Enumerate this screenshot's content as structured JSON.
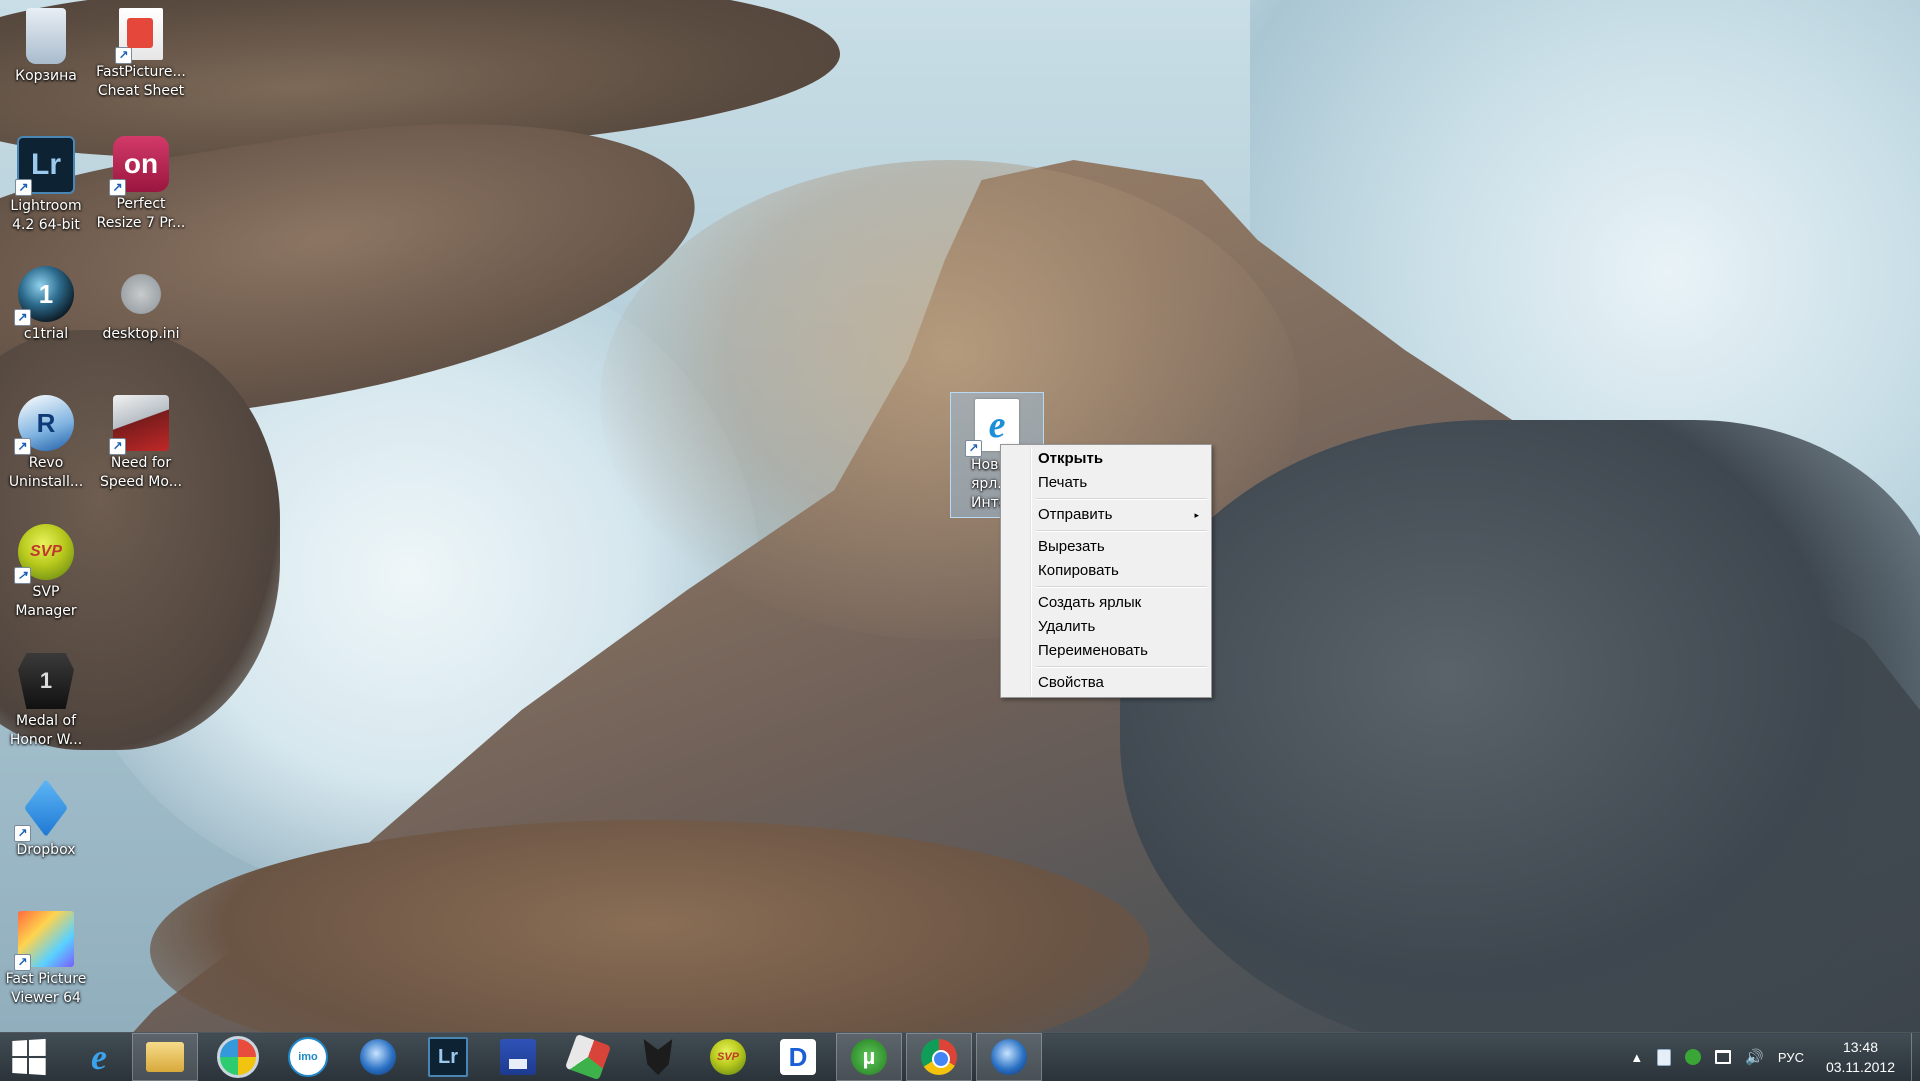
{
  "desktop": {
    "icons": [
      {
        "label": "Корзина",
        "icon": "recycle-bin-icon"
      },
      {
        "label": "FastPicture... Cheat Sheet",
        "icon": "pdf-document-icon"
      },
      {
        "label": "Lightroom 4.2 64-bit",
        "icon": "lightroom-icon"
      },
      {
        "label": "Perfect Resize 7 Pr...",
        "icon": "perfect-resize-icon"
      },
      {
        "label": "c1trial",
        "icon": "capture-one-icon"
      },
      {
        "label": "desktop.ini",
        "icon": "gear-settings-file-icon"
      },
      {
        "label": "Revo Uninstall...",
        "icon": "revo-uninstaller-icon"
      },
      {
        "label": "Need for Speed Mo...",
        "icon": "need-for-speed-icon"
      },
      {
        "label": "SVP Manager",
        "icon": "svp-icon"
      },
      {
        "label": "Medal of Honor W...",
        "icon": "medal-of-honor-icon"
      },
      {
        "label": "Dropbox",
        "icon": "dropbox-icon"
      },
      {
        "label": "Fast Picture Viewer 64",
        "icon": "fast-picture-viewer-icon"
      }
    ],
    "glyphs": {
      "lightroom": "Lr",
      "perfect_resize": "on",
      "c1": "1",
      "revo": "R",
      "svp": "SVP",
      "moh": "1",
      "ie": "e",
      "shortcut": "↗"
    },
    "selected_shortcut": {
      "label": "Нов... ярл... Интер...",
      "icon": "internet-explorer-shortcut-icon"
    }
  },
  "context_menu": {
    "items": [
      {
        "label": "Открыть",
        "bold": true
      },
      {
        "label": "Печать"
      },
      {
        "separator": true
      },
      {
        "label": "Отправить",
        "submenu": true
      },
      {
        "separator": true
      },
      {
        "label": "Вырезать"
      },
      {
        "label": "Копировать"
      },
      {
        "separator": true
      },
      {
        "label": "Создать ярлык"
      },
      {
        "label": "Удалить"
      },
      {
        "label": "Переименовать"
      },
      {
        "separator": true
      },
      {
        "label": "Свойства"
      }
    ],
    "submenu_arrow": "▸"
  },
  "taskbar": {
    "pinned": [
      {
        "name": "internet-explorer",
        "icon": "internet-explorer-icon",
        "glyph": "e"
      },
      {
        "name": "file-explorer",
        "icon": "folder-icon",
        "glyph": ""
      },
      {
        "name": "picasa",
        "icon": "picasa-icon",
        "glyph": ""
      },
      {
        "name": "imo",
        "icon": "imo-messenger-icon",
        "glyph": "imo"
      },
      {
        "name": "thunderbird",
        "icon": "thunderbird-icon",
        "glyph": ""
      },
      {
        "name": "lightroom",
        "icon": "lightroom-icon",
        "glyph": "Lr"
      },
      {
        "name": "save",
        "icon": "floppy-disk-icon",
        "glyph": ""
      },
      {
        "name": "paint",
        "icon": "paint-icon",
        "glyph": ""
      },
      {
        "name": "fox",
        "icon": "fox-head-icon",
        "glyph": ""
      },
      {
        "name": "svp",
        "icon": "svp-icon",
        "glyph": "SVP"
      },
      {
        "name": "daemon-tools",
        "icon": "daemon-tools-icon",
        "glyph": "D"
      },
      {
        "name": "utorrent",
        "icon": "utorrent-icon",
        "glyph": "µ"
      },
      {
        "name": "chrome",
        "icon": "chrome-icon",
        "glyph": ""
      },
      {
        "name": "thunderbird-2",
        "icon": "thunderbird-icon",
        "glyph": ""
      }
    ],
    "active_indices": [
      1,
      11,
      12,
      13
    ],
    "tray": {
      "show_hidden": "▲",
      "volume_glyph": "🔊",
      "language": "РУС",
      "time": "13:48",
      "date": "03.11.2012"
    }
  }
}
